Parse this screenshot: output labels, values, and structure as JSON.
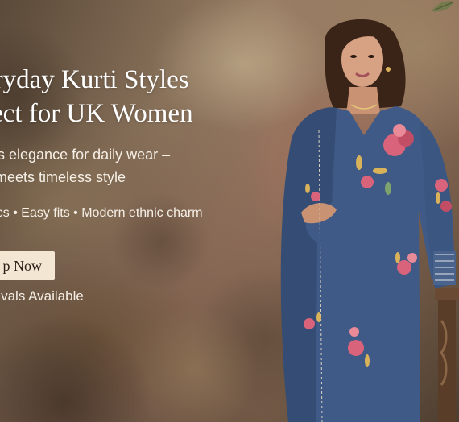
{
  "banner": {
    "headline_line1": "eryday Kurti Styles",
    "headline_line2": "fect for UK Women",
    "subtitle_line1": "ess elegance for daily wear –",
    "subtitle_line2": "rt meets timeless style",
    "features": "brics • Easy fits • Modern ethnic charm",
    "cta_label": "p Now",
    "arrivals_note": "rrivals Available"
  },
  "colors": {
    "text": "#ffffff",
    "cta_background": "#f3e6d3",
    "cta_text": "#2c2018",
    "kurti_blue": "#3f5a86",
    "embroidery_pink": "#d8637a",
    "embroidery_gold": "#d9b25a"
  },
  "imagery": {
    "model_description_icon": "woman-in-blue-kurti-illustration",
    "leaf_icon": "leaf-icon",
    "stand_icon": "wooden-stand-icon"
  }
}
